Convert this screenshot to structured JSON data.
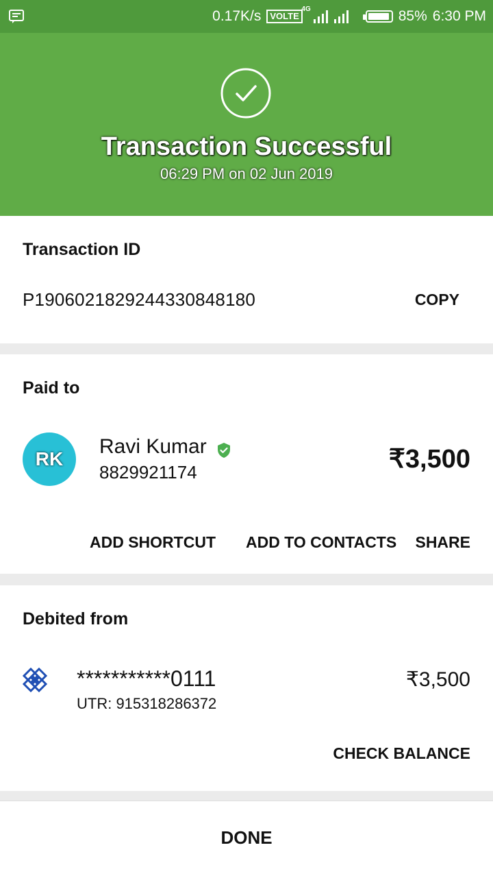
{
  "status_bar": {
    "net_speed": "0.17K/s",
    "volte": "VOLTE",
    "network": "4G",
    "battery": "85%",
    "time": "6:30 PM"
  },
  "header": {
    "title": "Transaction Successful",
    "datetime": "06:29 PM on 02 Jun 2019",
    "icon": "check-circle-icon",
    "bg_color": "#60ac47"
  },
  "transaction": {
    "label": "Transaction ID",
    "id": "P1906021829244330848180",
    "copy_label": "COPY"
  },
  "paid_to": {
    "label": "Paid to",
    "initials": "RK",
    "name": "Ravi Kumar",
    "phone": "8829921174",
    "amount": "₹3,500",
    "actions": [
      "ADD SHORTCUT",
      "ADD TO CONTACTS",
      "SHARE"
    ]
  },
  "debited_from": {
    "label": "Debited from",
    "account": "***********0111",
    "utr": "UTR: 915318286372",
    "amount": "₹3,500",
    "check_balance": "CHECK BALANCE"
  },
  "footer": {
    "done_label": "DONE"
  }
}
